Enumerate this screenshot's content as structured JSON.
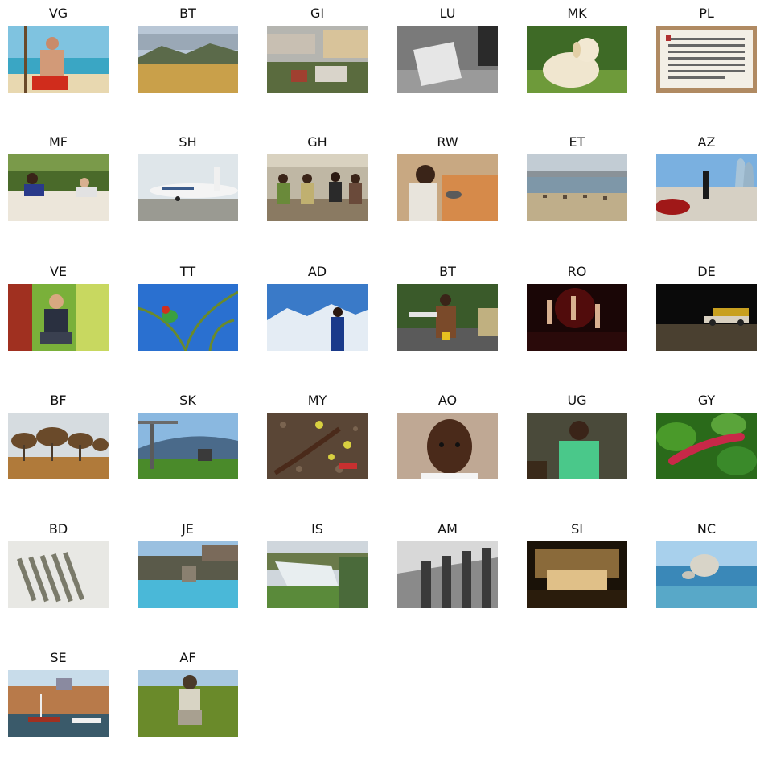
{
  "figure": {
    "panels": [
      {
        "code": "VG",
        "scene": "beach-portrait"
      },
      {
        "code": "BT",
        "scene": "grassland-valley"
      },
      {
        "code": "GI",
        "scene": "hillside-town"
      },
      {
        "code": "LU",
        "scene": "sign-grayscale"
      },
      {
        "code": "MK",
        "scene": "puppy-grass"
      },
      {
        "code": "PL",
        "scene": "text-plaque"
      },
      {
        "code": "MF",
        "scene": "people-lounge"
      },
      {
        "code": "SH",
        "scene": "airport-plane"
      },
      {
        "code": "GH",
        "scene": "group-seated"
      },
      {
        "code": "RW",
        "scene": "woman-cooking"
      },
      {
        "code": "ET",
        "scene": "lakeshore-camels"
      },
      {
        "code": "AZ",
        "scene": "memorial-towers"
      },
      {
        "code": "VE",
        "scene": "man-chair"
      },
      {
        "code": "TT",
        "scene": "parrot-palm"
      },
      {
        "code": "AD",
        "scene": "snowy-mountains"
      },
      {
        "code": "BT",
        "scene": "archery-festival"
      },
      {
        "code": "RO",
        "scene": "concert-crowd"
      },
      {
        "code": "DE",
        "scene": "night-car"
      },
      {
        "code": "BF",
        "scene": "savanna-trees"
      },
      {
        "code": "SK",
        "scene": "chairlift"
      },
      {
        "code": "MY",
        "scene": "plant-soil"
      },
      {
        "code": "AO",
        "scene": "child-portrait"
      },
      {
        "code": "UG",
        "scene": "young-man"
      },
      {
        "code": "GY",
        "scene": "red-flower-leaves"
      },
      {
        "code": "BD",
        "scene": "fence-sticks"
      },
      {
        "code": "JE",
        "scene": "coastal-fort"
      },
      {
        "code": "IS",
        "scene": "waterfall"
      },
      {
        "code": "AM",
        "scene": "columns-grayscale"
      },
      {
        "code": "SI",
        "scene": "concert-hall"
      },
      {
        "code": "NC",
        "scene": "rock-sea"
      },
      {
        "code": "SE",
        "scene": "harbor-boats"
      },
      {
        "code": "AF",
        "scene": "man-field"
      }
    ]
  }
}
